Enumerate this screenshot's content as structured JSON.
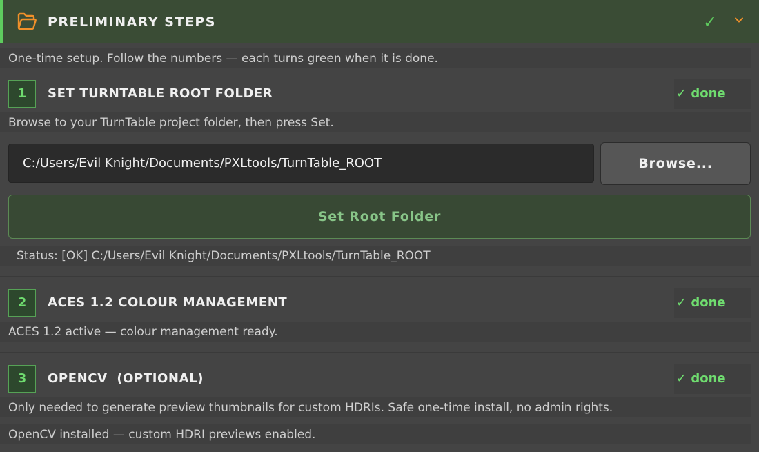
{
  "header": {
    "title": "PRELIMINARY STEPS",
    "status_mark": "✓",
    "icon": "folder-open-icon",
    "chevron": "chevron-down-icon"
  },
  "intro": "One-time setup. Follow the numbers — each turns green when it is done.",
  "steps": [
    {
      "number": "1",
      "title": "SET TURNTABLE ROOT FOLDER",
      "badge": "✓ done",
      "hint": "Browse to your TurnTable project folder, then press Set.",
      "path_value": "C:/Users/Evil Knight/Documents/PXLtools/TurnTable_ROOT",
      "browse_label": "Browse...",
      "set_label": "Set Root Folder",
      "status": "Status: [OK] C:/Users/Evil Knight/Documents/PXLtools/TurnTable_ROOT"
    },
    {
      "number": "2",
      "title": "ACES 1.2 COLOUR MANAGEMENT",
      "badge": "✓ done",
      "hint": "ACES 1.2 active — colour management ready."
    },
    {
      "number": "3",
      "title": "OPENCV  (OPTIONAL)",
      "badge": "✓ done",
      "hint": "Only needed to generate preview thumbnails for custom HDRIs. Safe one-time install, no admin rights.",
      "status": "OpenCV installed — custom HDRI previews enabled."
    }
  ],
  "colors": {
    "accent_green": "#5ecb5e",
    "header_bg": "#3a4c35",
    "panel_bg": "#444444",
    "folder_orange": "#f0902a"
  }
}
